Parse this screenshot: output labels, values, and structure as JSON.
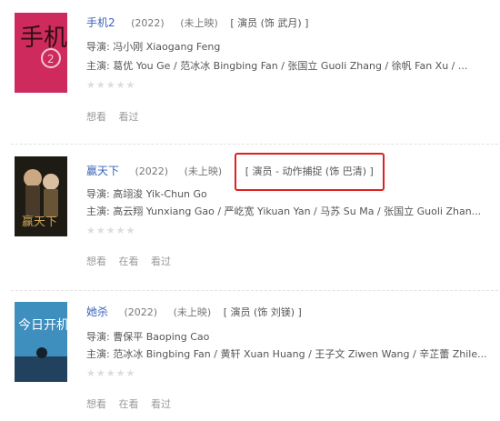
{
  "movies": [
    {
      "title": "手机2",
      "year": "(2022)",
      "status": "(未上映)",
      "role": "[ 演员 (饰 武月) ]",
      "director": "导演: 冯小刚 Xiaogang Feng",
      "cast": "主演: 葛优 You Ge / 范冰冰 Bingbing Fan / 张国立 Guoli Zhang / 徐帆 Fan Xu / ...",
      "stars": "★★★★★",
      "actions": [
        "想看",
        "看过"
      ],
      "poster_text": "手机"
    },
    {
      "title": "赢天下",
      "year": "(2022)",
      "status": "(未上映)",
      "role": "[ 演员 - 动作捕捉 (饰 巴清) ]",
      "director": "导演: 高翊浚 Yik-Chun Go",
      "cast": "主演: 高云翔 Yunxiang Gao / 严屹宽 Yikuan Yan / 马苏 Su Ma / 张国立 Guoli Zhan...",
      "stars": "★★★★★",
      "actions": [
        "想看",
        "在看",
        "看过"
      ],
      "poster_text": "赢天下"
    },
    {
      "title": "她杀",
      "year": "(2022)",
      "status": "(未上映)",
      "role": "[ 演员 (饰 刘镁) ]",
      "director": "导演: 曹保平 Baoping Cao",
      "cast": "主演: 范冰冰 Bingbing Fan / 黄轩 Xuan Huang / 王子文 Ziwen Wang / 辛芷蕾 Zhile...",
      "stars": "★★★★★",
      "actions": [
        "想看",
        "在看",
        "看过"
      ],
      "poster_text": "今日开机"
    }
  ],
  "colors": {
    "link": "#3a64b8",
    "highlight_box": "#e02020"
  }
}
